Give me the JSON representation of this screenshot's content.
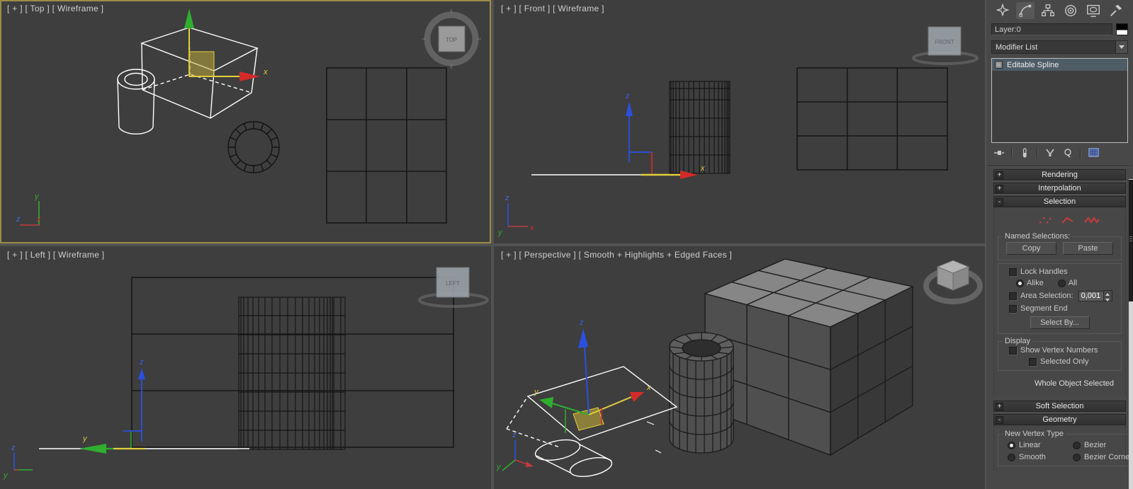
{
  "viewports": {
    "top": {
      "label": "[ + ] [ Top ] [ Wireframe ]",
      "cube": "TOP"
    },
    "front": {
      "label": "[ + ] [ Front ] [ Wireframe ]",
      "cube": "FRONT"
    },
    "left": {
      "label": "[ + ] [ Left ] [ Wireframe ]",
      "cube": "LEFT"
    },
    "perspective": {
      "label": "[ + ] [ Perspective ] [ Smooth + Highlights + Edged Faces ]"
    }
  },
  "axis": {
    "x": "x",
    "y": "y",
    "z": "z"
  },
  "panel": {
    "tabs": [
      "create-icon",
      "modify-icon",
      "hierarchy-icon",
      "motion-icon",
      "display-icon",
      "utilities-icon"
    ],
    "layer_value": "Layer:0",
    "modifier_list": "Modifier List",
    "stack_item": "Editable Spline",
    "stack_tools": [
      "pin-stack-icon",
      "show-end-result-icon",
      "make-unique-icon",
      "remove-modifier-icon",
      "configure-modifier-sets-icon"
    ],
    "subobject_icons": [
      "vertex-icon",
      "segment-icon",
      "spline-icon"
    ],
    "rollouts": [
      {
        "title": "Rendering",
        "state": "+"
      },
      {
        "title": "Interpolation",
        "state": "+"
      },
      {
        "title": "Selection",
        "state": "-"
      },
      {
        "title": "Soft Selection",
        "state": "+"
      },
      {
        "title": "Geometry",
        "state": "-"
      }
    ],
    "selection": {
      "named_selections": "Named Selections:",
      "copy": "Copy",
      "paste": "Paste",
      "lock_handles": "Lock Handles",
      "alike": "Alike",
      "all": "All",
      "area_selection": "Area Selection:",
      "area_value": "0,001",
      "segment_end": "Segment End",
      "select_by": "Select By...",
      "display_group": "Display",
      "show_vertex_numbers": "Show Vertex Numbers",
      "selected_only": "Selected Only",
      "status": "Whole Object Selected"
    },
    "geometry": {
      "new_vertex_type": "New Vertex Type",
      "linear": "Linear",
      "bezier": "Bezier",
      "smooth": "Smooth",
      "bezier_corner": "Bezier Corner"
    }
  },
  "colors": {
    "viewport_bg": "#3e3e3e",
    "active_viewport_border": "#9c8c46",
    "panel_bg": "#484848",
    "stack_selection_row": "#4e5c66",
    "subobject_red": "#c23b3b",
    "axis_x": "#d42a2a",
    "axis_y": "#2fae2f",
    "axis_z": "#2b50e0",
    "gizmo_highlight": "#e3cf3c",
    "wireframe_selected": "#ffffff",
    "wireframe_dark": "#161616"
  }
}
